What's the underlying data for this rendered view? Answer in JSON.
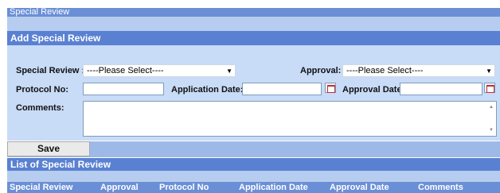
{
  "window": {
    "title": "Special Review"
  },
  "add_section": {
    "header": "Add Special Review",
    "special_review_label": "Special Review :",
    "special_review_value": "----Please Select----",
    "approval_label": "Approval:",
    "approval_value": "----Please Select----",
    "protocol_label": "Protocol No:",
    "protocol_value": "",
    "application_date_label": "Application Date:",
    "application_date_value": "",
    "approval_date_label": "Approval Date:",
    "approval_date_value": "",
    "comments_label": "Comments:",
    "comments_value": ""
  },
  "actions": {
    "save_label": "Save"
  },
  "list_section": {
    "header": "List of Special Review",
    "columns": [
      "Special Review",
      "Approval",
      "Protocol No",
      "Application Date",
      "Approval Date",
      "Comments"
    ]
  },
  "icons": {
    "dropdown": "chevron-down-icon",
    "calendar": "calendar-icon"
  },
  "colors": {
    "header_blue": "#5a81d1",
    "band_blue": "#6b8fd6",
    "form_bg": "#c8dbf7"
  }
}
